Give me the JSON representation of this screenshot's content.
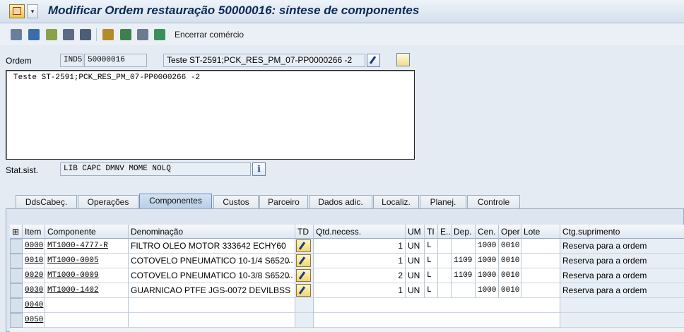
{
  "title": "Modificar Ordem restauração 50000016: síntese de componentes",
  "toolbar": {
    "text_button": "Encerrar comércio"
  },
  "header": {
    "ordem_label": "Ordem",
    "ordem_type": "IND5",
    "ordem_number": "50000016",
    "short_text": "Teste ST-2591;PCK_RES_PM_07-PP0000266 -2",
    "long_text": "Teste ST-2591;PCK_RES_PM_07-PP0000266 -2",
    "status_label": "Stat.sist.",
    "status_value": "LIB  CAPC DMNV MOME NOLQ"
  },
  "tabs": [
    "DdsCabeç.",
    "Operações",
    "Componentes",
    "Custos",
    "Parceiro",
    "Dados adic.",
    "Localiz.",
    "Planej.",
    "Controle"
  ],
  "active_tab": "Componentes",
  "table": {
    "headers": [
      "Item",
      "Componente",
      "Denominação",
      "TD",
      "Qtd.necess.",
      "UM",
      "TI",
      "E..",
      "Dep.",
      "Cen.",
      "Oper",
      "Lote",
      "Ctg.suprimento"
    ],
    "rows": [
      {
        "item": "0000",
        "componente": "MT1000-4777-R",
        "denominacao": "FILTRO OLEO MOTOR 333642 ECHY60",
        "qtd": "1",
        "um": "UN",
        "ti": "L",
        "e": "",
        "dep": "",
        "cen": "1000",
        "oper": "0010",
        "lote": "",
        "ctg": "Reserva para a ordem"
      },
      {
        "item": "0010",
        "componente": "MT1000-0005",
        "denominacao": "COTOVELO PNEUMATICO 10-1/4 S6520",
        "qtd": "1",
        "um": "UN",
        "ti": "L",
        "e": "",
        "dep": "1109",
        "cen": "1000",
        "oper": "0010",
        "lote": "",
        "ctg": "Reserva para a ordem"
      },
      {
        "item": "0020",
        "componente": "MT1000-0009",
        "denominacao": "COTOVELO PNEUMATICO 10-3/8 S6520",
        "qtd": "2",
        "um": "UN",
        "ti": "L",
        "e": "",
        "dep": "1109",
        "cen": "1000",
        "oper": "0010",
        "lote": "",
        "ctg": "Reserva para a ordem"
      },
      {
        "item": "0030",
        "componente": "MT1000-1402",
        "denominacao": "GUARNICAO PTFE JGS-0072 DEVILBSS",
        "qtd": "1",
        "um": "UN",
        "ti": "L",
        "e": "",
        "dep": "",
        "cen": "1000",
        "oper": "0010",
        "lote": "",
        "ctg": "Reserva para a ordem"
      }
    ],
    "empty_items": [
      "0040",
      "0050"
    ]
  },
  "colors": {
    "title": "#0a2a56",
    "panel": "#e4ebf3",
    "active_tab": "#b7cde6"
  },
  "icons": [
    "object-menu-icon",
    "execute-icon",
    "calculator-icon",
    "hierarchy-icon",
    "filter-icon",
    "print-icon",
    "components-icon",
    "operations-icon",
    "document-icon",
    "release-icon",
    "edit-long-text-icon",
    "create-icon",
    "info-icon",
    "pen-edit-icon",
    "select-all-icon"
  ]
}
